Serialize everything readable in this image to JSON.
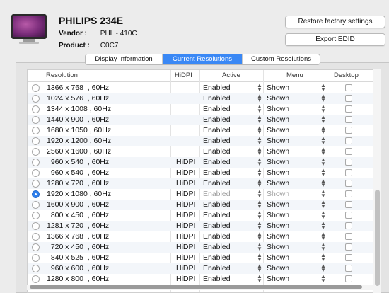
{
  "display": {
    "name": "PHILIPS 234E",
    "vendor_label": "Vendor :",
    "vendor_value": "PHL - 410C",
    "product_label": "Product :",
    "product_value": "C0C7"
  },
  "buttons": {
    "restore": "Restore factory settings",
    "export": "Export EDID"
  },
  "tabs": [
    {
      "label": "Display Information",
      "active": false
    },
    {
      "label": "Current Resolutions",
      "active": true
    },
    {
      "label": "Custom Resolutions",
      "active": false
    }
  ],
  "table": {
    "headers": {
      "resolution": "Resolution",
      "hidpi": "HiDPI",
      "active": "Active",
      "menu": "Menu",
      "desktop": "Desktop"
    },
    "rows": [
      {
        "res": "1366 x 768  , 60Hz",
        "hidpi": "",
        "active": "Enabled",
        "menu": "Shown",
        "selected": false
      },
      {
        "res": "1024 x 576  , 60Hz",
        "hidpi": "",
        "active": "Enabled",
        "menu": "Shown",
        "selected": false
      },
      {
        "res": "1344 x 1008 , 60Hz",
        "hidpi": "",
        "active": "Enabled",
        "menu": "Shown",
        "selected": false
      },
      {
        "res": "1440 x 900  , 60Hz",
        "hidpi": "",
        "active": "Enabled",
        "menu": "Shown",
        "selected": false
      },
      {
        "res": "1680 x 1050 , 60Hz",
        "hidpi": "",
        "active": "Enabled",
        "menu": "Shown",
        "selected": false
      },
      {
        "res": "1920 x 1200 , 60Hz",
        "hidpi": "",
        "active": "Enabled",
        "menu": "Shown",
        "selected": false
      },
      {
        "res": "2560 x 1600 , 60Hz",
        "hidpi": "",
        "active": "Enabled",
        "menu": "Shown",
        "selected": false
      },
      {
        "res": "  960 x 540  , 60Hz",
        "hidpi": "HiDPI",
        "active": "Enabled",
        "menu": "Shown",
        "selected": false
      },
      {
        "res": "  960 x 540  , 60Hz",
        "hidpi": "HiDPI",
        "active": "Enabled",
        "menu": "Shown",
        "selected": false
      },
      {
        "res": "1280 x 720  , 60Hz",
        "hidpi": "HiDPI",
        "active": "Enabled",
        "menu": "Shown",
        "selected": false
      },
      {
        "res": "1920 x 1080 , 60Hz",
        "hidpi": "HiDPI",
        "active": "Enabled",
        "menu": "Shown",
        "selected": true
      },
      {
        "res": "1600 x 900  , 60Hz",
        "hidpi": "HiDPI",
        "active": "Enabled",
        "menu": "Shown",
        "selected": false
      },
      {
        "res": "  800 x 450  , 60Hz",
        "hidpi": "HiDPI",
        "active": "Enabled",
        "menu": "Shown",
        "selected": false
      },
      {
        "res": "1281 x 720  , 60Hz",
        "hidpi": "HiDPI",
        "active": "Enabled",
        "menu": "Shown",
        "selected": false
      },
      {
        "res": "1366 x 768  , 60Hz",
        "hidpi": "HiDPI",
        "active": "Enabled",
        "menu": "Shown",
        "selected": false
      },
      {
        "res": "  720 x 450  , 60Hz",
        "hidpi": "HiDPI",
        "active": "Enabled",
        "menu": "Shown",
        "selected": false
      },
      {
        "res": "  840 x 525  , 60Hz",
        "hidpi": "HiDPI",
        "active": "Enabled",
        "menu": "Shown",
        "selected": false
      },
      {
        "res": "  960 x 600  , 60Hz",
        "hidpi": "HiDPI",
        "active": "Enabled",
        "menu": "Shown",
        "selected": false
      },
      {
        "res": "1280 x 800  , 60Hz",
        "hidpi": "HiDPI",
        "active": "Enabled",
        "menu": "Shown",
        "selected": false
      }
    ]
  },
  "colors": {
    "accent": "#3a88f5",
    "radio_selected": "#2f80ed"
  }
}
